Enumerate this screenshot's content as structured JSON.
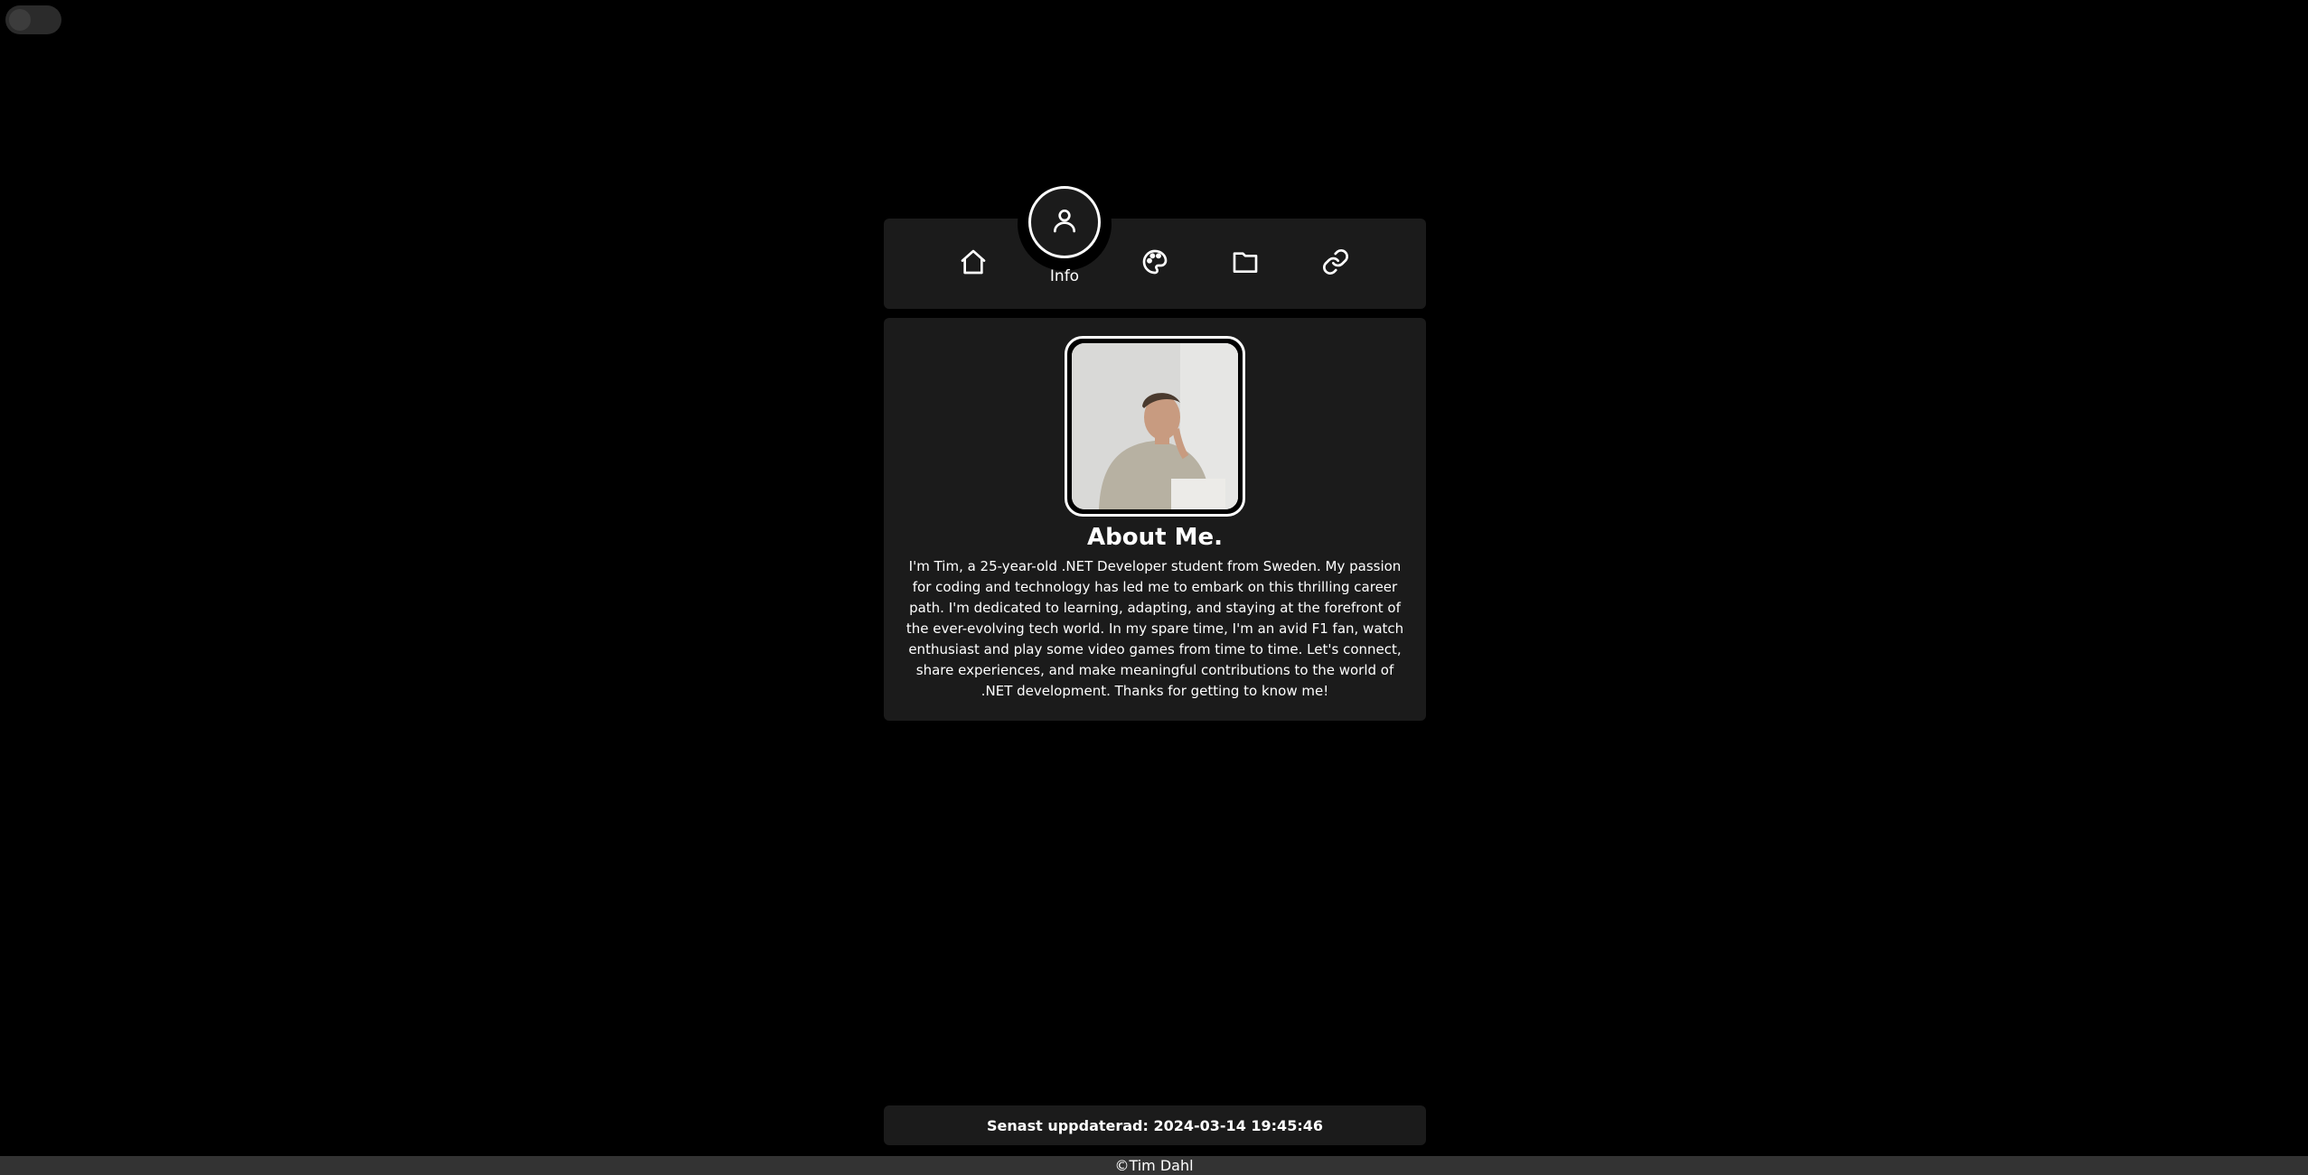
{
  "theme_toggle": {
    "state": "off"
  },
  "nav": {
    "active_item": {
      "label": "Info",
      "icon": "user-icon"
    },
    "items": [
      {
        "name": "home",
        "icon": "home-icon"
      },
      {
        "name": "palette",
        "icon": "palette-icon"
      },
      {
        "name": "folder",
        "icon": "folder-icon"
      },
      {
        "name": "link",
        "icon": "link-icon"
      }
    ]
  },
  "about": {
    "photo_alt": "profile-photo",
    "title": "About Me.",
    "text": "I'm Tim, a 25-year-old .NET Developer student from Sweden. My passion for coding and technology has led me to embark on this thrilling career path. I'm dedicated to learning, adapting, and staying at the forefront of the ever-evolving tech world. In my spare time, I'm an avid F1 fan, watch enthusiast and play some video games from time to time. Let's connect, share experiences, and make meaningful contributions to the world of .NET development. Thanks for getting to know me!"
  },
  "footer": {
    "updated": "Senast uppdaterad: 2024-03-14 19:45:46",
    "copyright": "©Tim Dahl"
  },
  "colors": {
    "background": "#000000",
    "card": "#1b1b1b",
    "text": "#ffffff",
    "footer_bar": "#333333"
  }
}
